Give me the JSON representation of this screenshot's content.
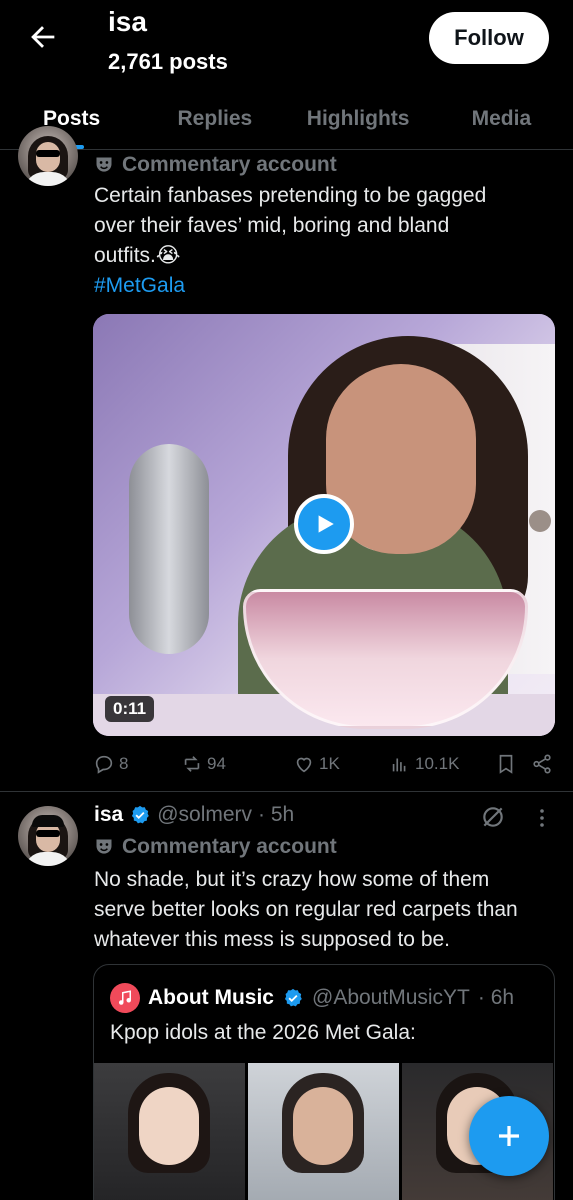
{
  "header": {
    "title": "isa",
    "posts_count": "2,761 posts",
    "follow_label": "Follow"
  },
  "tabs": [
    {
      "label": "Posts",
      "active": true
    },
    {
      "label": "Replies",
      "active": false
    },
    {
      "label": "Highlights",
      "active": false
    },
    {
      "label": "Media",
      "active": false
    }
  ],
  "post1": {
    "badge": "Commentary account",
    "text_line1": "Certain fanbases pretending to be gagged",
    "text_line2": "over their faves’ mid, boring and bland",
    "text_line3": "outfits.😭",
    "hashtag": "#MetGala",
    "video_duration": "0:11",
    "stats": {
      "replies": "8",
      "reposts": "94",
      "likes": "1K",
      "views": "10.1K"
    }
  },
  "post2": {
    "name": "isa",
    "handle": "@solmerv",
    "time": "· 5h",
    "badge": "Commentary account",
    "text_line1": "No shade, but it’s crazy how some of them",
    "text_line2": "serve better looks on regular red carpets than",
    "text_line3": "whatever this mess is supposed to be.",
    "quote": {
      "name": "About Music",
      "handle": "@AboutMusicYT",
      "time": "· 6h",
      "text": "Kpop idols at the 2026 Met Gala:"
    }
  },
  "colors": {
    "accent": "#1d9bf0",
    "muted": "#71767b",
    "background": "#000000"
  }
}
